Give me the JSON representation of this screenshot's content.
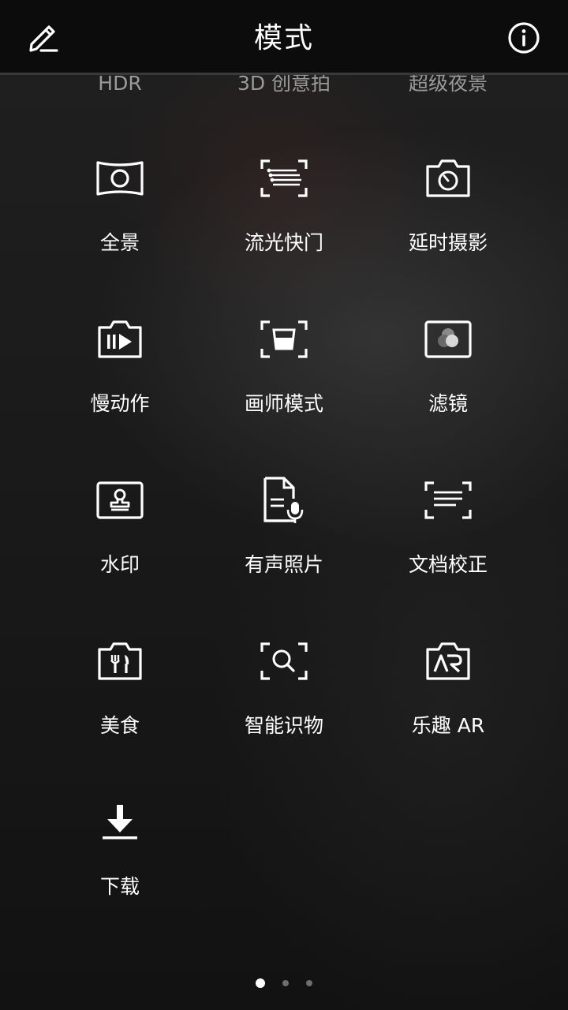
{
  "header": {
    "title": "模式",
    "edit_icon": "pencil-edit-icon",
    "info_icon": "info-circle-icon"
  },
  "partial_row": [
    {
      "label": "HDR"
    },
    {
      "label": "3D 创意拍"
    },
    {
      "label": "超级夜景"
    }
  ],
  "modes": [
    {
      "label": "全景",
      "icon": "panorama-icon"
    },
    {
      "label": "流光快门",
      "icon": "light-painting-icon"
    },
    {
      "label": "延时摄影",
      "icon": "time-lapse-icon"
    },
    {
      "label": "慢动作",
      "icon": "slow-motion-icon"
    },
    {
      "label": "画师模式",
      "icon": "artist-mode-icon"
    },
    {
      "label": "滤镜",
      "icon": "filter-icon"
    },
    {
      "label": "水印",
      "icon": "watermark-icon"
    },
    {
      "label": "有声照片",
      "icon": "audio-photo-icon"
    },
    {
      "label": "文档校正",
      "icon": "document-correction-icon"
    },
    {
      "label": "美食",
      "icon": "food-icon"
    },
    {
      "label": "智能识物",
      "icon": "object-recognition-icon"
    },
    {
      "label": "乐趣 AR",
      "icon": "ar-fun-icon"
    },
    {
      "label": "下载",
      "icon": "download-icon"
    }
  ],
  "pagination": {
    "pages": 3,
    "current": 1
  },
  "colors": {
    "header_bg": "#0c0c0c",
    "text": "#ffffff",
    "dim_text": "#9a9a9a",
    "dot_inactive": "#6e6e6e"
  }
}
